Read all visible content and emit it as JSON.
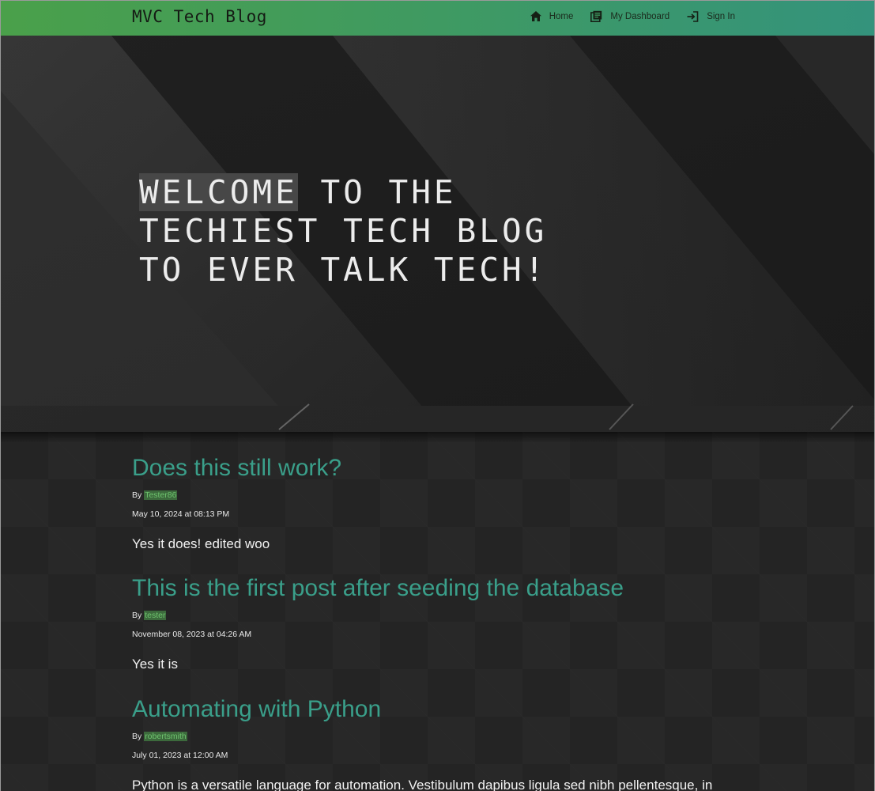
{
  "nav": {
    "brand": "MVC Tech Blog",
    "links": [
      {
        "label": "Home",
        "icon": "home-icon"
      },
      {
        "label": "My Dashboard",
        "icon": "dashboard-icon"
      },
      {
        "label": "Sign In",
        "icon": "sign-in-icon"
      }
    ]
  },
  "hero": {
    "title_highlight": "WELCOME",
    "title_rest": " TO THE TECHIEST TECH BLOG TO EVER TALK TECH!"
  },
  "posts": [
    {
      "title": "Does this still work?",
      "by_label": "By",
      "author": "Tester86",
      "date": "May 10, 2024 at 08:13 PM",
      "body": "Yes it does! edited woo"
    },
    {
      "title": "This is the first post after seeding the database",
      "by_label": "By",
      "author": "tester",
      "date": "November 08, 2023 at 04:26 AM",
      "body": "Yes it is"
    },
    {
      "title": "Automating with Python",
      "by_label": "By",
      "author": "robertsmith",
      "date": "July 01, 2023 at 12:00 AM",
      "body": "Python is a versatile language for automation. Vestibulum dapibus ligula sed nibh pellentesque, in"
    }
  ],
  "colors": {
    "nav_gradient_start": "#4aa04a",
    "nav_gradient_end": "#34937c",
    "post_title": "#3a9f8a",
    "author_link": "#6ec36e",
    "background": "#232323"
  }
}
